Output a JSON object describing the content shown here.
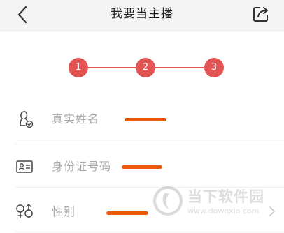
{
  "header": {
    "title": "我要当主播",
    "back_icon": "chevron-left-icon",
    "share_icon": "share-icon"
  },
  "steps": {
    "items": [
      "1",
      "2",
      "3"
    ],
    "color": "#e25454"
  },
  "form": {
    "fields": [
      {
        "label": "真实姓名",
        "icon": "user-verified-icon"
      },
      {
        "label": "身份证号码",
        "icon": "id-card-icon"
      },
      {
        "label": "性别",
        "icon": "gender-icon"
      }
    ],
    "redaction_color": "#ea5b10"
  },
  "watermark": {
    "title": "当下软件园",
    "url": "www.downxia.com"
  }
}
